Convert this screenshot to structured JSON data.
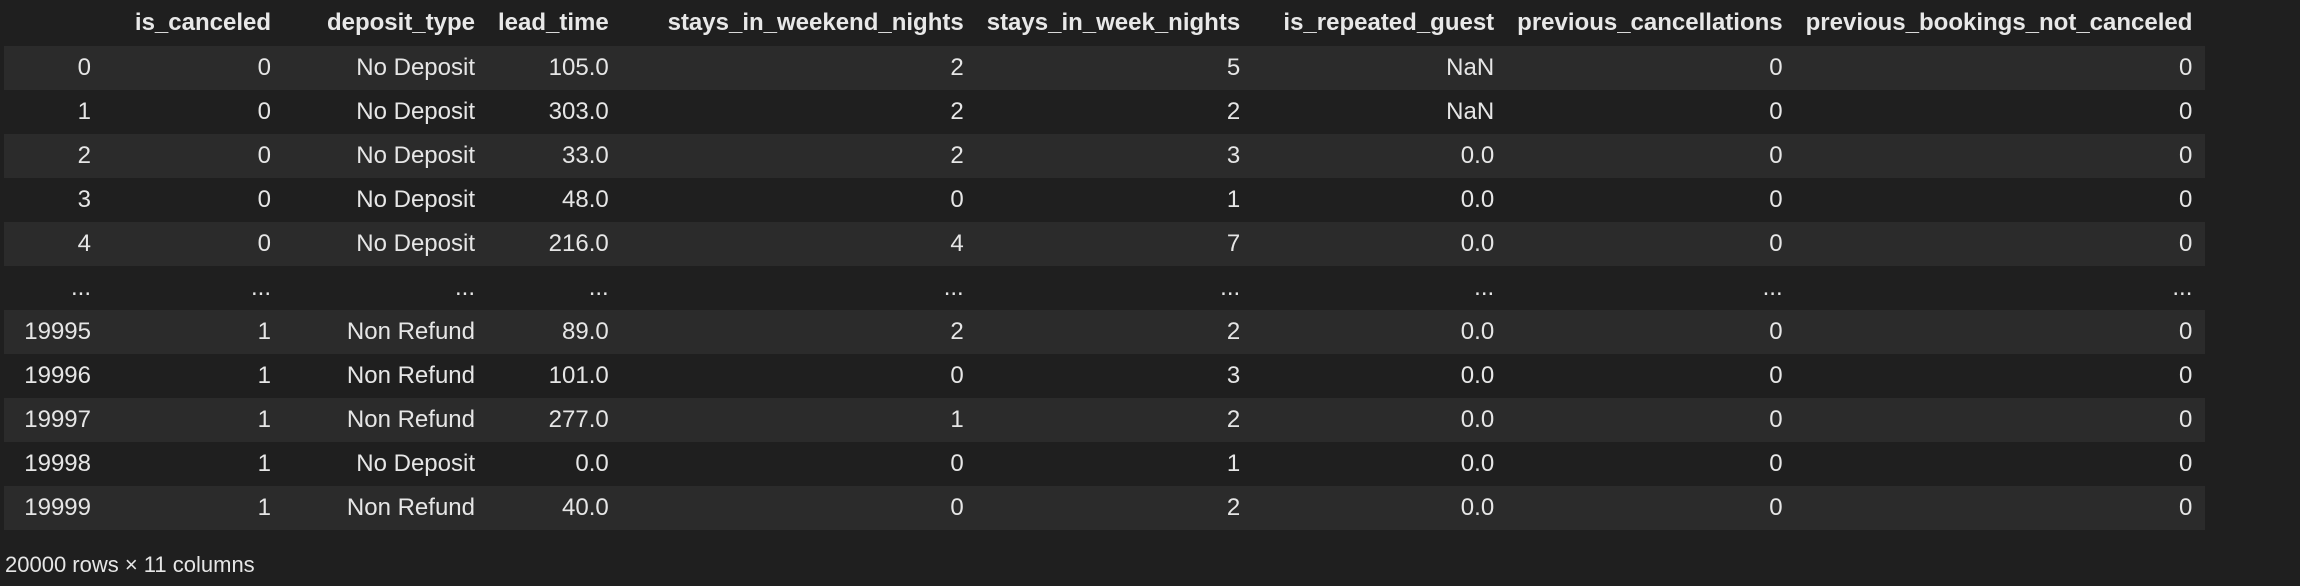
{
  "columns": [
    "is_canceled",
    "deposit_type",
    "lead_time",
    "stays_in_weekend_nights",
    "stays_in_week_nights",
    "is_repeated_guest",
    "previous_cancellations",
    "previous_bookings_not_canceled"
  ],
  "rows": [
    {
      "index": "0",
      "cells": [
        "0",
        "No Deposit",
        "105.0",
        "2",
        "5",
        "NaN",
        "0",
        "0"
      ]
    },
    {
      "index": "1",
      "cells": [
        "0",
        "No Deposit",
        "303.0",
        "2",
        "2",
        "NaN",
        "0",
        "0"
      ]
    },
    {
      "index": "2",
      "cells": [
        "0",
        "No Deposit",
        "33.0",
        "2",
        "3",
        "0.0",
        "0",
        "0"
      ]
    },
    {
      "index": "3",
      "cells": [
        "0",
        "No Deposit",
        "48.0",
        "0",
        "1",
        "0.0",
        "0",
        "0"
      ]
    },
    {
      "index": "4",
      "cells": [
        "0",
        "No Deposit",
        "216.0",
        "4",
        "7",
        "0.0",
        "0",
        "0"
      ]
    },
    {
      "index": "...",
      "cells": [
        "...",
        "...",
        "...",
        "...",
        "...",
        "...",
        "...",
        "..."
      ]
    },
    {
      "index": "19995",
      "cells": [
        "1",
        "Non Refund",
        "89.0",
        "2",
        "2",
        "0.0",
        "0",
        "0"
      ]
    },
    {
      "index": "19996",
      "cells": [
        "1",
        "Non Refund",
        "101.0",
        "0",
        "3",
        "0.0",
        "0",
        "0"
      ]
    },
    {
      "index": "19997",
      "cells": [
        "1",
        "Non Refund",
        "277.0",
        "1",
        "2",
        "0.0",
        "0",
        "0"
      ]
    },
    {
      "index": "19998",
      "cells": [
        "1",
        "No Deposit",
        "0.0",
        "0",
        "1",
        "0.0",
        "0",
        "0"
      ]
    },
    {
      "index": "19999",
      "cells": [
        "1",
        "Non Refund",
        "40.0",
        "0",
        "2",
        "0.0",
        "0",
        "0"
      ]
    }
  ],
  "shape_note": "20000 rows × 11 columns",
  "colors": {
    "background": "#1f1f1f",
    "stripe": "#2b2b2b",
    "text": "#e6e6e6"
  }
}
